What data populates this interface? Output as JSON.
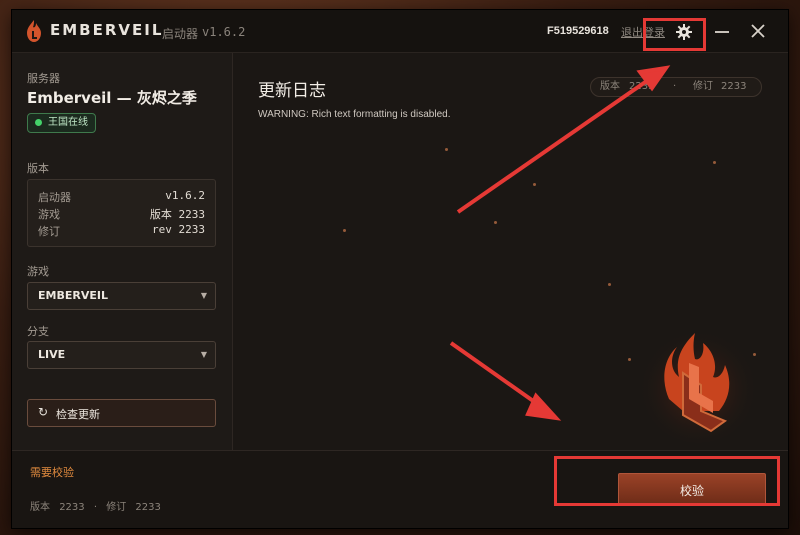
{
  "app": {
    "name": "EMBERVEIL",
    "subtitle": "启动器",
    "version": "v1.6.2"
  },
  "header": {
    "user_id": "F519529618",
    "logout": "退出登录"
  },
  "sidebar": {
    "server_label": "服务器",
    "server_name": "Emberveil — 灰烬之季",
    "status": "王国在线",
    "version_label": "版本",
    "versions": [
      {
        "name": "启动器",
        "value": "v1.6.2"
      },
      {
        "name": "游戏",
        "value": "版本 2233"
      },
      {
        "name": "修订",
        "value": "rev 2233"
      }
    ],
    "game_label": "游戏",
    "game_value": "EMBERVEIL",
    "branch_label": "分支",
    "branch_value": "LIVE",
    "check_update": "检查更新"
  },
  "main": {
    "title": "更新日志",
    "pill": {
      "v_label": "版本",
      "v_value": "2233",
      "sep": "·",
      "r_label": "修订",
      "r_value": "2233"
    },
    "warning": "WARNING: Rich text formatting is disabled."
  },
  "bottom": {
    "need_check": "需要校验",
    "ver_label": "版本",
    "ver_value": "2233",
    "sep": "·",
    "rev_label": "修订",
    "rev_value": "2233",
    "verify": "校验"
  },
  "colors": {
    "accent": "#e08a3e",
    "online": "#44d36a",
    "annotation": "#e53935"
  }
}
